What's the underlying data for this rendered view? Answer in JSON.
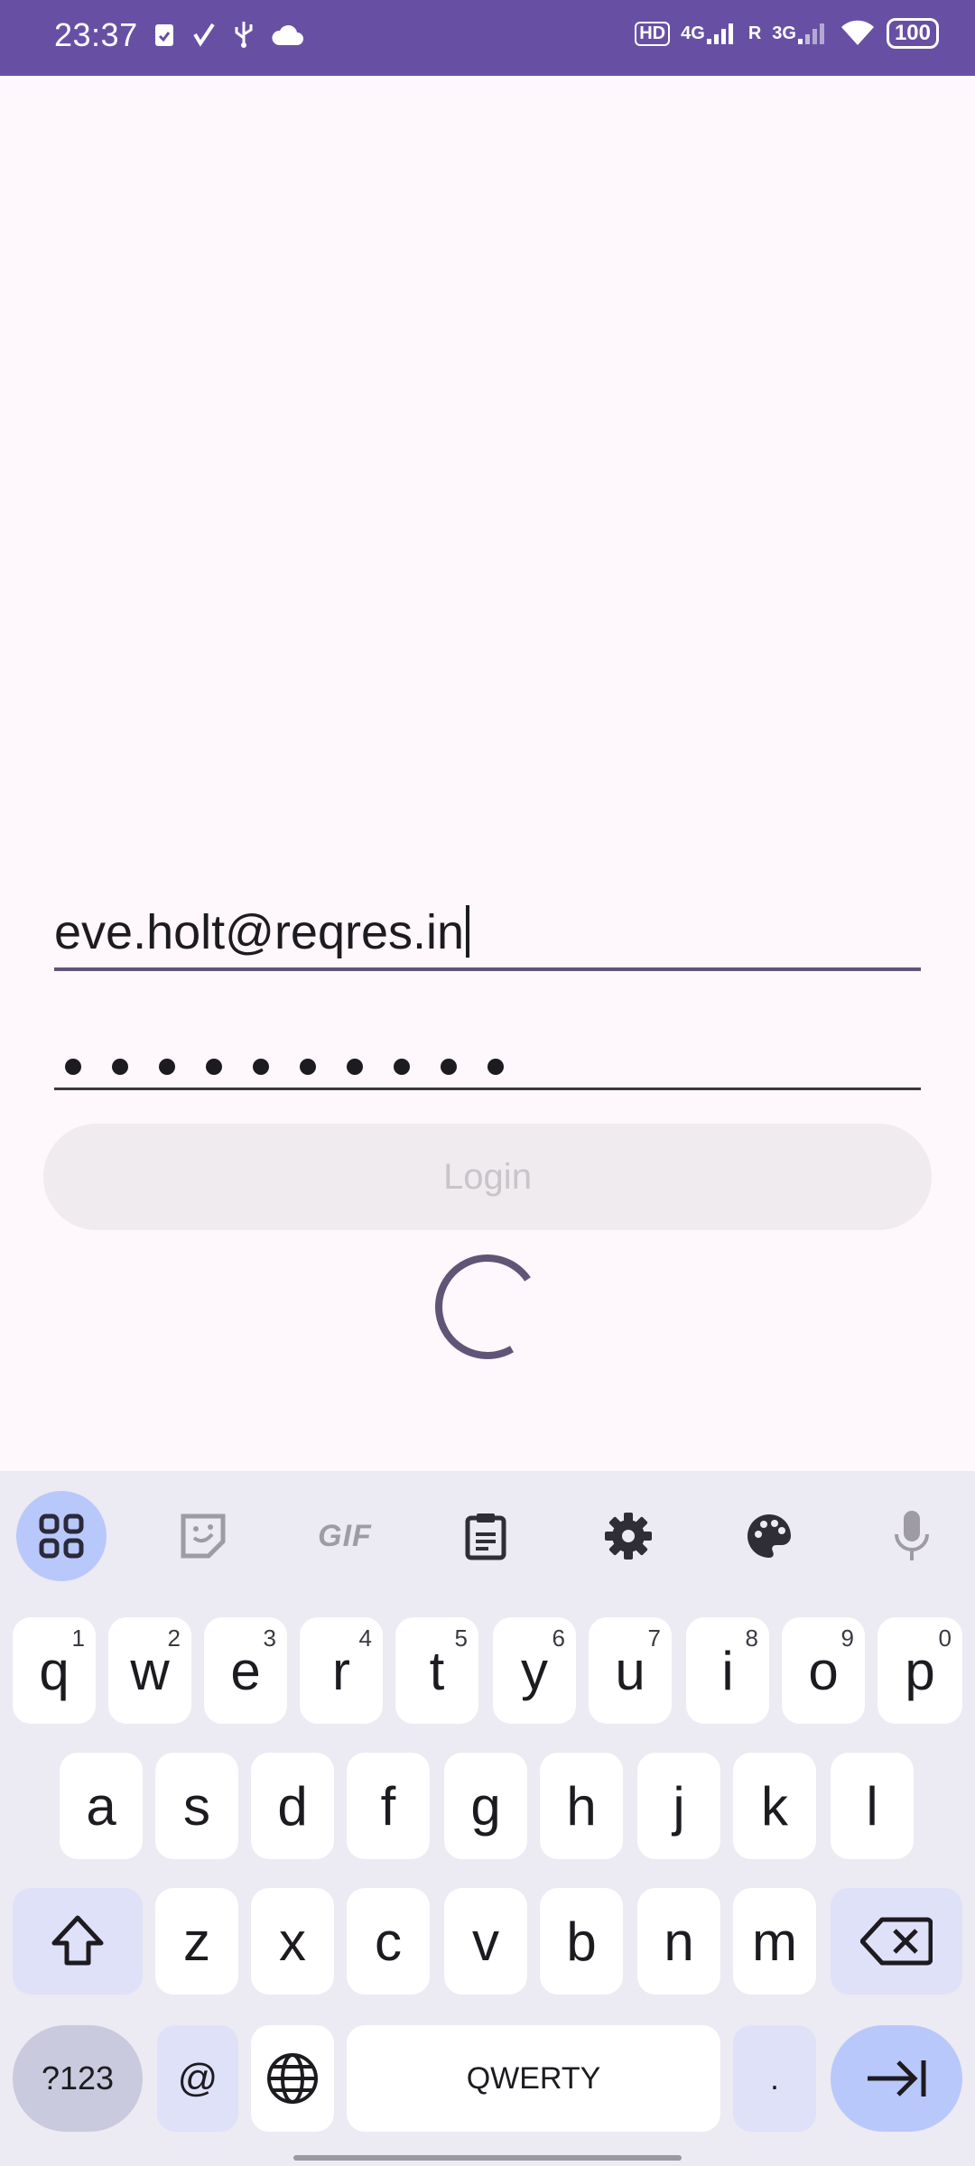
{
  "status_bar": {
    "time": "23:37",
    "left_icons": [
      "clipboard-check-icon",
      "check-mark-icon",
      "usb-icon",
      "cloud-icon"
    ],
    "hd_label": "HD",
    "sim1_label": "4G",
    "roaming_label": "R",
    "sim2_label": "3G",
    "battery": "100"
  },
  "form": {
    "email_value": "eve.holt@reqres.in",
    "password_masked_count": 10,
    "login_label": "Login"
  },
  "keyboard": {
    "toolbar": [
      "apps-grid-icon",
      "sticker-icon",
      "gif-icon",
      "clipboard-icon",
      "settings-icon",
      "palette-icon",
      "microphone-icon"
    ],
    "gif_label": "GIF",
    "row1": [
      {
        "key": "q",
        "hint": "1"
      },
      {
        "key": "w",
        "hint": "2"
      },
      {
        "key": "e",
        "hint": "3"
      },
      {
        "key": "r",
        "hint": "4"
      },
      {
        "key": "t",
        "hint": "5"
      },
      {
        "key": "y",
        "hint": "6"
      },
      {
        "key": "u",
        "hint": "7"
      },
      {
        "key": "i",
        "hint": "8"
      },
      {
        "key": "o",
        "hint": "9"
      },
      {
        "key": "p",
        "hint": "0"
      }
    ],
    "row2": [
      "a",
      "s",
      "d",
      "f",
      "g",
      "h",
      "j",
      "k",
      "l"
    ],
    "row3": [
      "z",
      "x",
      "c",
      "v",
      "b",
      "n",
      "m"
    ],
    "symbols_label": "?123",
    "at_label": "@",
    "space_label": "QWERTY",
    "period_label": "."
  }
}
